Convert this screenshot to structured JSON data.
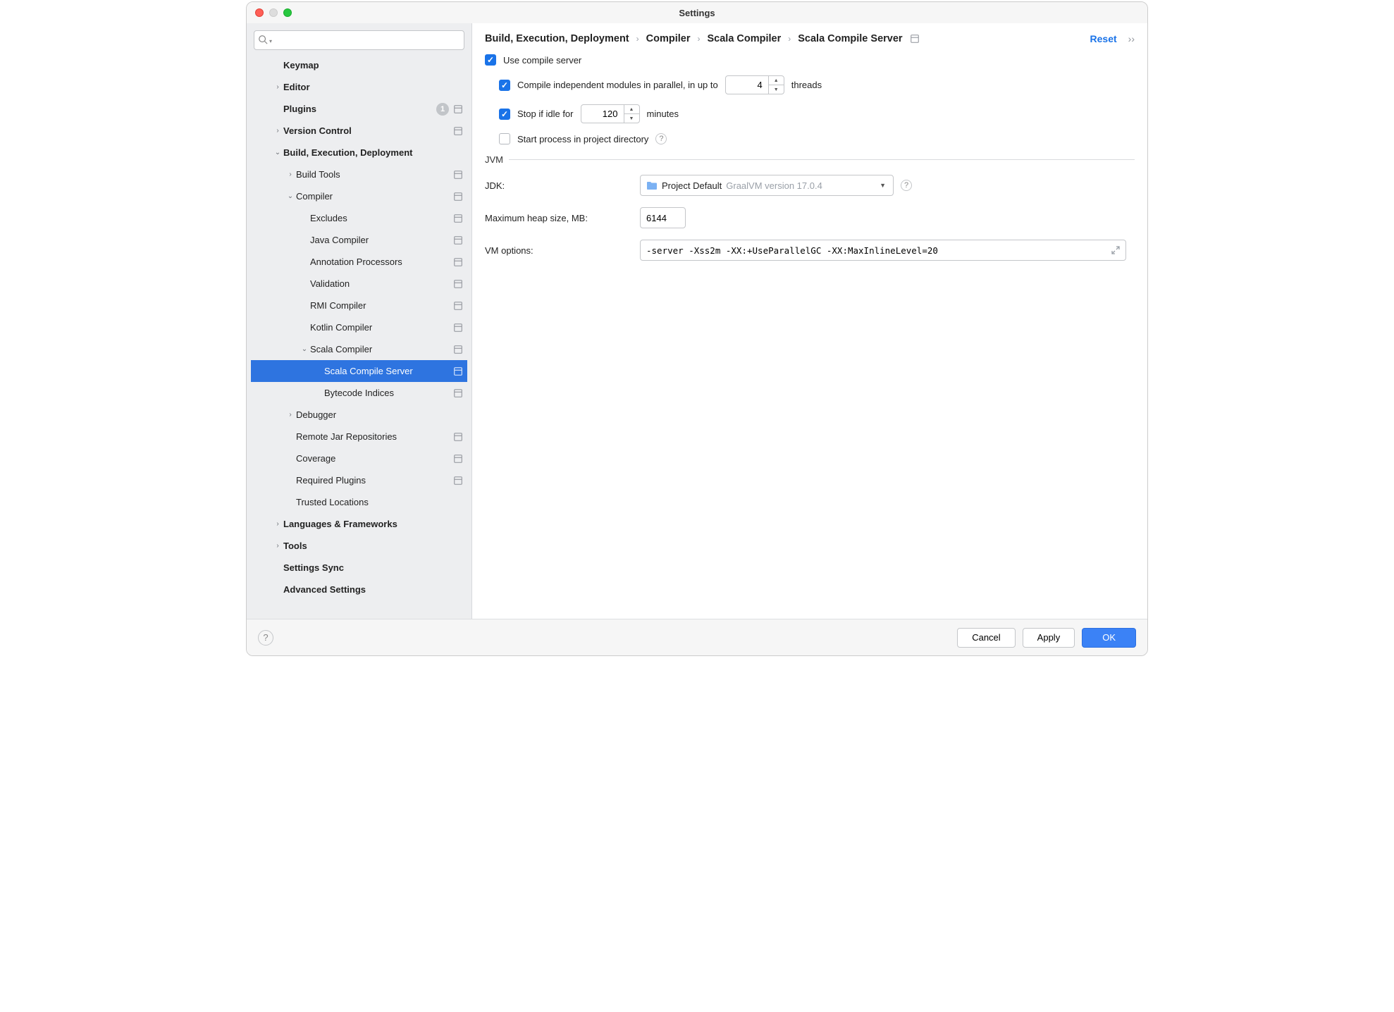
{
  "window": {
    "title": "Settings"
  },
  "search": {
    "placeholder": ""
  },
  "sidebar": {
    "partialTop": "Keymap",
    "items": [
      {
        "label": "Editor",
        "level": 0,
        "bold": true,
        "chevron": "right",
        "scope": false
      },
      {
        "label": "Plugins",
        "level": 0,
        "bold": true,
        "chevron": "none",
        "badge": "1",
        "scope": true
      },
      {
        "label": "Version Control",
        "level": 0,
        "bold": true,
        "chevron": "right",
        "scope": true
      },
      {
        "label": "Build, Execution, Deployment",
        "level": 0,
        "bold": true,
        "chevron": "down",
        "scope": false
      },
      {
        "label": "Build Tools",
        "level": 1,
        "bold": false,
        "chevron": "right",
        "scope": true
      },
      {
        "label": "Compiler",
        "level": 1,
        "bold": false,
        "chevron": "down",
        "scope": true
      },
      {
        "label": "Excludes",
        "level": 2,
        "bold": false,
        "chevron": "none",
        "scope": true
      },
      {
        "label": "Java Compiler",
        "level": 2,
        "bold": false,
        "chevron": "none",
        "scope": true
      },
      {
        "label": "Annotation Processors",
        "level": 2,
        "bold": false,
        "chevron": "none",
        "scope": true
      },
      {
        "label": "Validation",
        "level": 2,
        "bold": false,
        "chevron": "none",
        "scope": true
      },
      {
        "label": "RMI Compiler",
        "level": 2,
        "bold": false,
        "chevron": "none",
        "scope": true
      },
      {
        "label": "Kotlin Compiler",
        "level": 2,
        "bold": false,
        "chevron": "none",
        "scope": true
      },
      {
        "label": "Scala Compiler",
        "level": 2,
        "bold": false,
        "chevron": "down",
        "scope": true
      },
      {
        "label": "Scala Compile Server",
        "level": 3,
        "bold": false,
        "chevron": "none",
        "scope": true,
        "selected": true
      },
      {
        "label": "Bytecode Indices",
        "level": 3,
        "bold": false,
        "chevron": "none",
        "scope": true
      },
      {
        "label": "Debugger",
        "level": 1,
        "bold": false,
        "chevron": "right",
        "scope": false
      },
      {
        "label": "Remote Jar Repositories",
        "level": 1,
        "bold": false,
        "chevron": "none",
        "scope": true
      },
      {
        "label": "Coverage",
        "level": 1,
        "bold": false,
        "chevron": "none",
        "scope": true
      },
      {
        "label": "Required Plugins",
        "level": 1,
        "bold": false,
        "chevron": "none",
        "scope": true
      },
      {
        "label": "Trusted Locations",
        "level": 1,
        "bold": false,
        "chevron": "none",
        "scope": false
      },
      {
        "label": "Languages & Frameworks",
        "level": 0,
        "bold": true,
        "chevron": "right",
        "scope": false
      },
      {
        "label": "Tools",
        "level": 0,
        "bold": true,
        "chevron": "right",
        "scope": false
      },
      {
        "label": "Settings Sync",
        "level": 0,
        "bold": true,
        "chevron": "none",
        "scope": false
      },
      {
        "label": "Advanced Settings",
        "level": 0,
        "bold": true,
        "chevron": "none",
        "scope": false
      }
    ]
  },
  "breadcrumb": {
    "parts": [
      "Build, Execution, Deployment",
      "Compiler",
      "Scala Compiler",
      "Scala Compile Server"
    ],
    "reset": "Reset"
  },
  "settings": {
    "useCompileServer": {
      "label": "Use compile server",
      "checked": true
    },
    "parallel": {
      "label": "Compile independent modules in parallel, in up to",
      "checked": true,
      "value": "4",
      "suffix": "threads"
    },
    "stopIdle": {
      "label": "Stop if idle for",
      "checked": true,
      "value": "120",
      "suffix": "minutes"
    },
    "startInProject": {
      "label": "Start process in project directory",
      "checked": false
    },
    "jvmSection": "JVM",
    "jdk": {
      "label": "JDK:",
      "value": "Project Default",
      "hint": "GraalVM version 17.0.4"
    },
    "heap": {
      "label": "Maximum heap size, MB:",
      "value": "6144"
    },
    "vmopts": {
      "label": "VM options:",
      "value": "-server -Xss2m -XX:+UseParallelGC -XX:MaxInlineLevel=20"
    }
  },
  "footer": {
    "cancel": "Cancel",
    "apply": "Apply",
    "ok": "OK",
    "help": "?"
  }
}
